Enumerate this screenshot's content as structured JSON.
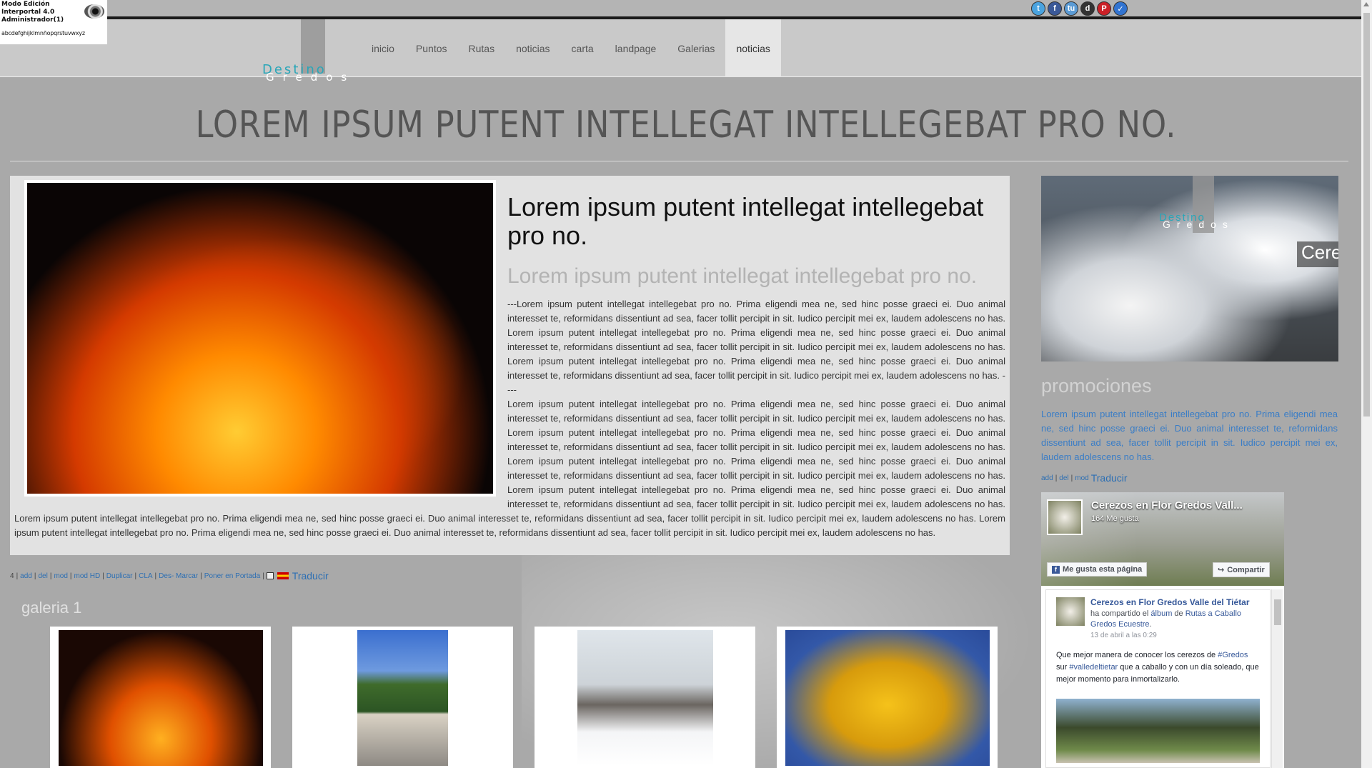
{
  "edit_box": {
    "line1": "Modo Edición",
    "line2": "Interportal 4.0",
    "line3": "Administrador(1)",
    "alphabet": "abcdefghijklmnñopqrstuvwxyz"
  },
  "social_icons": [
    "twitter-icon",
    "facebook-icon",
    "tuenti-icon",
    "digg-icon",
    "pinterest-icon",
    "delicious-icon"
  ],
  "logo": {
    "line1": "Destino",
    "line2": "Gredos"
  },
  "nav": [
    "inicio",
    "Puntos",
    "Rutas",
    "noticias",
    "carta",
    "landpage",
    "Galerias",
    "noticias"
  ],
  "page_title": "LOREM IPSUM PUTENT INTELLEGAT INTELLEGEBAT PRO NO.",
  "article": {
    "heading": "Lorem ipsum putent intellegat intellegebat pro no.",
    "subheading": "Lorem ipsum putent intellegat intellegebat pro no.",
    "paragraph1": "---Lorem ipsum putent intellegat intellegebat pro no. Prima eligendi mea ne, sed hinc posse graeci ei. Duo animal interesset te, reformidans dissentiunt ad sea, facer tollit percipit in sit. Iudico percipit mei ex, laudem adolescens no has. Lorem ipsum putent intellegat intellegebat pro no. Prima eligendi mea ne, sed hinc posse graeci ei. Duo animal interesset te, reformidans dissentiunt ad sea, facer tollit percipit in sit. Iudico percipit mei ex, laudem adolescens no has. Lorem ipsum putent intellegat intellegebat pro no. Prima eligendi mea ne, sed hinc posse graeci ei. Duo animal interesset te, reformidans dissentiunt ad sea, facer tollit percipit in sit. Iudico percipit mei ex, laudem adolescens no has. ----",
    "paragraph2": "Lorem ipsum putent intellegat intellegebat pro no. Prima eligendi mea ne, sed hinc posse graeci ei. Duo animal interesset te, reformidans dissentiunt ad sea, facer tollit percipit in sit. Iudico percipit mei ex, laudem adolescens no has. Lorem ipsum putent intellegat intellegebat pro no. Prima eligendi mea ne, sed hinc posse graeci ei. Duo animal interesset te, reformidans dissentiunt ad sea, facer tollit percipit in sit. Iudico percipit mei ex, laudem adolescens no has. Lorem ipsum putent intellegat intellegebat pro no. Prima eligendi mea ne, sed hinc posse graeci ei. Duo animal interesset te, reformidans dissentiunt ad sea, facer tollit percipit in sit. Iudico percipit mei ex, laudem adolescens no has. Lorem ipsum putent intellegat intellegebat pro no. Prima eligendi mea ne, sed hinc posse graeci ei. Duo animal interesset te, reformidans dissentiunt ad sea, facer tollit percipit in sit. Iudico percipit mei ex, laudem adolescens no has. Lorem ipsum putent intellegat intellegebat pro no. Prima eligendi mea ne, sed hinc posse graeci ei. Duo animal interesset te, reformidans dissentiunt ad sea, facer tollit percipit in sit. Iudico percipit mei ex, laudem adolescens no has. Lorem ipsum putent intellegat intellegebat pro no. Prima eligendi mea ne, sed hinc posse graeci ei. Duo animal interesset te, reformidans dissentiunt ad sea, facer tollit percipit in sit. Iudico percipit mei ex, laudem adolescens no has."
  },
  "admin_links": {
    "count": "4",
    "links": [
      "add",
      "del",
      "mod",
      "mod HD",
      "Duplicar",
      "CLA",
      "Des- Marcar",
      "Poner en Portada"
    ],
    "translate": "Traducir"
  },
  "gallery": {
    "title": "galeria 1"
  },
  "sidebar": {
    "banner_logo1": "Destino",
    "banner_logo2": "Gredos",
    "banner_caption": "Cere",
    "promo_title": "promociones",
    "promo_text": "Lorem ipsum putent intellegat intellegebat pro no. Prima eligendi mea ne, sed hinc posse graeci ei. Duo animal interesset te, reformidans dissentiunt ad sea, facer tollit percipit in sit. Iudico percipit mei ex, laudem adolescens no has.",
    "promo_links": [
      "add",
      "del",
      "mod"
    ],
    "promo_translate": "Traducir"
  },
  "facebook": {
    "page_name": "Cerezos en Flor Gredos Vall...",
    "likes": "164 Me gusta",
    "like_button": "Me gusta esta página",
    "share_button": "Compartir",
    "post_author": "Cerezos en Flor Gredos Valle del Tiétar",
    "post_action": "ha compartido el",
    "post_album_word": "álbum",
    "post_de": "de",
    "post_album_owner": "Rutas a Caballo Gredos Ecuestre",
    "post_date": "13 de abril a las 0:29",
    "post_body_1": "Que mejor manera de conocer los cerezos de",
    "post_tag1": "#Gredos",
    "post_body_2": "sur",
    "post_tag2": "#valledeltietar",
    "post_body_3": "que a caballo y con un día soleado, que mejor momento para inmortalizarlo."
  }
}
